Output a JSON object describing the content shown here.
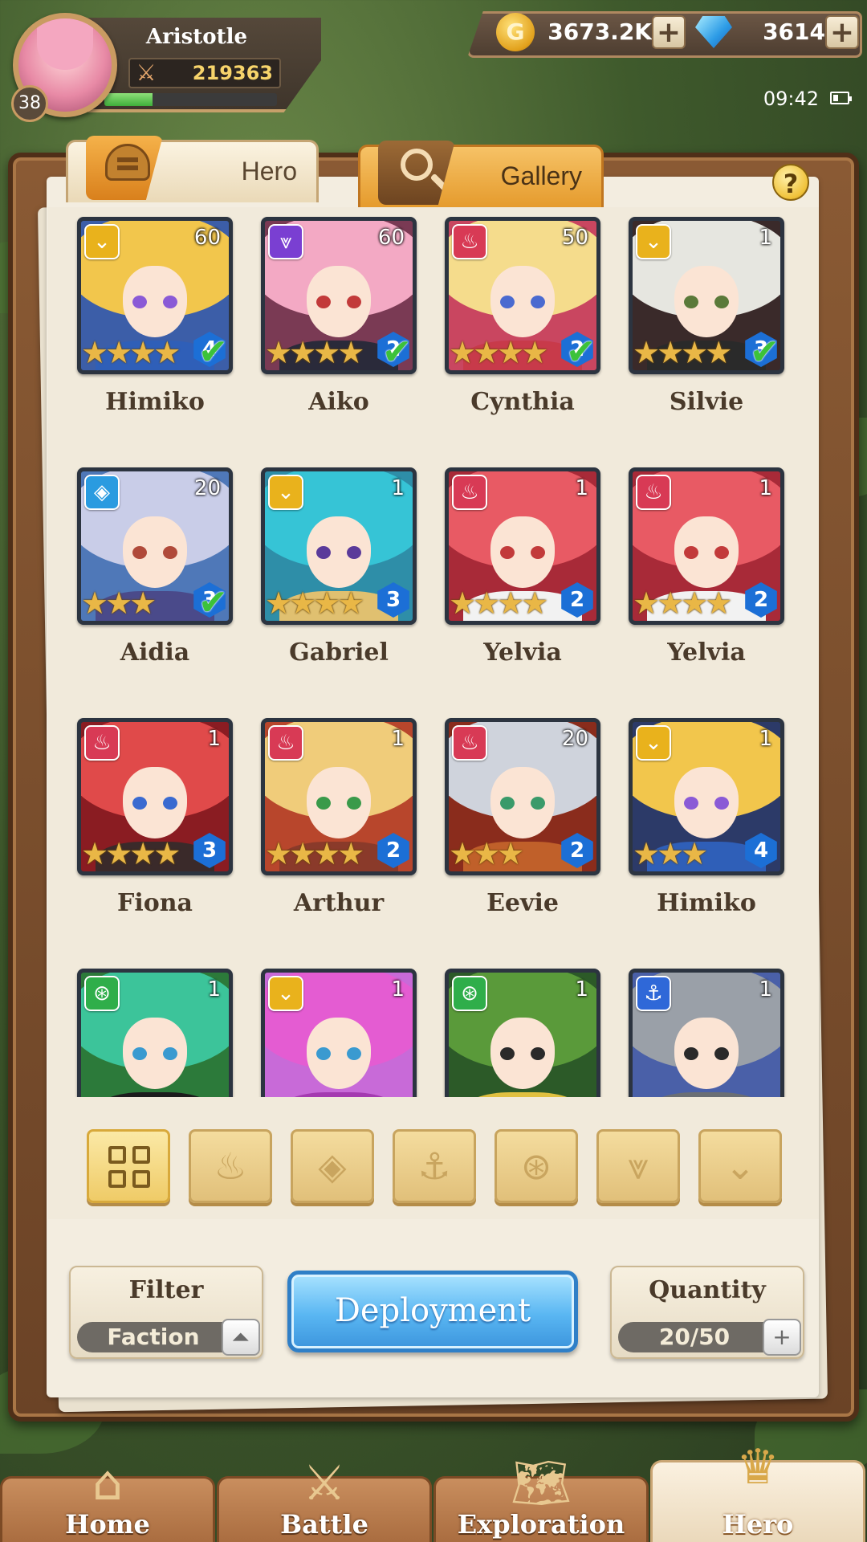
{
  "player": {
    "name": "Aristotle",
    "level": "38",
    "power": "219363",
    "xp_fraction": 0.28
  },
  "resources": {
    "gold": "3673.2K",
    "gems": "3614",
    "plus": "+"
  },
  "status": {
    "time": "09:42"
  },
  "tabs": [
    {
      "label": "Hero",
      "icon": "helmet-icon",
      "active": true
    },
    {
      "label": "Gallery",
      "icon": "magnifier-icon",
      "active": false
    }
  ],
  "help": "?",
  "factions": {
    "light": {
      "color": "#e9b21c",
      "glyph": "⌄",
      "icon": "light-faction-icon"
    },
    "dark": {
      "color": "#7a3fd2",
      "glyph": "⩔",
      "icon": "dark-faction-icon"
    },
    "fire": {
      "color": "#d83a55",
      "glyph": "♨",
      "icon": "fire-faction-icon"
    },
    "water": {
      "color": "#2a9be0",
      "glyph": "◈",
      "icon": "water-faction-icon"
    },
    "nature": {
      "color": "#2fae4a",
      "glyph": "⊛",
      "icon": "nature-faction-icon"
    },
    "anchor": {
      "color": "#2f68d8",
      "glyph": "⚓",
      "icon": "anchor-faction-icon"
    }
  },
  "heroes": [
    {
      "name": "Himiko",
      "level": "60",
      "stars": "★★★★",
      "rank": "4",
      "deployed": true,
      "faction": "light",
      "hair": "#f2c64c",
      "eye": "#8a5ad6",
      "body": "#2f5fb8",
      "bg": "#3c5ea8"
    },
    {
      "name": "Aiko",
      "level": "60",
      "stars": "★★★★",
      "rank": "2",
      "deployed": true,
      "faction": "dark",
      "hair": "#f3a9c4",
      "eye": "#c23a3a",
      "body": "#2a2a3a",
      "bg": "#7a3a54"
    },
    {
      "name": "Cynthia",
      "level": "50",
      "stars": "★★★★",
      "rank": "2",
      "deployed": true,
      "faction": "fire",
      "hair": "#f5dc8c",
      "eye": "#4a6ad0",
      "body": "#c83a4a",
      "bg": "#c94660"
    },
    {
      "name": "Silvie",
      "level": "1",
      "stars": "★★★★",
      "rank": "3",
      "deployed": true,
      "faction": "light",
      "hair": "#e6e6e0",
      "eye": "#5a7a3a",
      "body": "#2a2a2a",
      "bg": "#3a2a2a"
    },
    {
      "name": "Aidia",
      "level": "20",
      "stars": "★★★",
      "rank": "3",
      "deployed": true,
      "faction": "water",
      "hair": "#c9cde8",
      "eye": "#b04a3a",
      "body": "#4a4a8a",
      "bg": "#4f78b8"
    },
    {
      "name": "Gabriel",
      "level": "1",
      "stars": "★★★★",
      "rank": "3",
      "deployed": false,
      "faction": "light",
      "hair": "#36c4d6",
      "eye": "#5a3a9a",
      "body": "#e0c070",
      "bg": "#2e8ea8"
    },
    {
      "name": "Yelvia",
      "level": "1",
      "stars": "★★★★",
      "rank": "2",
      "deployed": false,
      "faction": "fire",
      "hair": "#e85a64",
      "eye": "#c23a3a",
      "body": "#f2f2f2",
      "bg": "#a82a38"
    },
    {
      "name": "Yelvia",
      "level": "1",
      "stars": "★★★★",
      "rank": "2",
      "deployed": false,
      "faction": "fire",
      "hair": "#e85a64",
      "eye": "#c23a3a",
      "body": "#f2f2f2",
      "bg": "#a82a38"
    },
    {
      "name": "Fiona",
      "level": "1",
      "stars": "★★★★",
      "rank": "3",
      "deployed": false,
      "faction": "fire",
      "hair": "#e04a4a",
      "eye": "#3a6ad0",
      "body": "#3a2a2a",
      "bg": "#8a1c22"
    },
    {
      "name": "Arthur",
      "level": "1",
      "stars": "★★★★",
      "rank": "2",
      "deployed": false,
      "faction": "fire",
      "hair": "#f0cc7a",
      "eye": "#3a9a4a",
      "body": "#8a3a2a",
      "bg": "#b8462c"
    },
    {
      "name": "Eevie",
      "level": "20",
      "stars": "★★★",
      "rank": "2",
      "deployed": false,
      "faction": "fire",
      "hair": "#cfd3dc",
      "eye": "#3a9a6a",
      "body": "#c0602a",
      "bg": "#8a2c1c"
    },
    {
      "name": "Himiko",
      "level": "1",
      "stars": "★★★",
      "rank": "4",
      "deployed": false,
      "faction": "light",
      "hair": "#f2c64c",
      "eye": "#8a5ad6",
      "body": "#2f5fb8",
      "bg": "#2c3a68"
    },
    {
      "name": "",
      "level": "1",
      "stars": "",
      "rank": "",
      "deployed": false,
      "faction": "nature",
      "hair": "#3cc49a",
      "eye": "#3a9ad0",
      "body": "#1c1c1c",
      "bg": "#2c7a3a"
    },
    {
      "name": "",
      "level": "1",
      "stars": "",
      "rank": "",
      "deployed": false,
      "faction": "light",
      "hair": "#e45cd2",
      "eye": "#3a9ad0",
      "body": "#a43ab0",
      "bg": "#c86ad8"
    },
    {
      "name": "",
      "level": "1",
      "stars": "",
      "rank": "",
      "deployed": false,
      "faction": "nature",
      "hair": "#5a9a3a",
      "eye": "#2a2a2a",
      "body": "#e0c040",
      "bg": "#2c5a28"
    },
    {
      "name": "",
      "level": "1",
      "stars": "",
      "rank": "",
      "deployed": false,
      "faction": "anchor",
      "hair": "#9aa0a8",
      "eye": "#2a2a2a",
      "body": "#6a6e74",
      "bg": "#4a60a8"
    }
  ],
  "filter_buttons": [
    {
      "name": "all-filter-button",
      "glyph": "",
      "active": true
    },
    {
      "name": "fire-filter-button",
      "glyph": "♨",
      "active": false
    },
    {
      "name": "water-filter-button",
      "glyph": "◈",
      "active": false
    },
    {
      "name": "anchor-filter-button",
      "glyph": "⚓",
      "active": false
    },
    {
      "name": "nature-filter-button",
      "glyph": "⊛",
      "active": false
    },
    {
      "name": "dark-filter-button",
      "glyph": "⩔",
      "active": false
    },
    {
      "name": "light-filter-button",
      "glyph": "⌄",
      "active": false
    }
  ],
  "controls": {
    "filter_label": "Filter",
    "filter_value": "Faction",
    "filter_arrow": "⏶",
    "deploy_label": "Deployment",
    "quantity_label": "Quantity",
    "quantity_value": "20/50",
    "quantity_plus": "+"
  },
  "nav": [
    {
      "label": "Home",
      "icon": "home-icon",
      "glyph": "⌂",
      "active": false
    },
    {
      "label": "Battle",
      "icon": "crossed-swords-icon",
      "glyph": "⚔",
      "active": false
    },
    {
      "label": "Exploration",
      "icon": "map-scroll-icon",
      "glyph": "🗺",
      "active": false
    },
    {
      "label": "Hero",
      "icon": "hero-crest-icon",
      "glyph": "♛",
      "active": true
    }
  ]
}
